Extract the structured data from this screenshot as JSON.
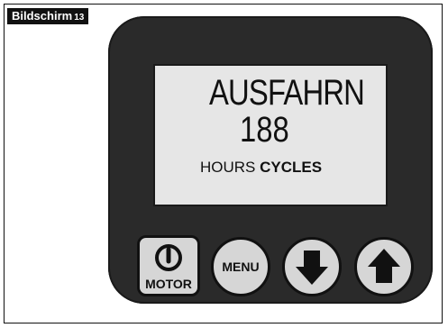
{
  "caption": {
    "label": "Bildschirm",
    "number": "13"
  },
  "display": {
    "line1": "AUSFAHRN",
    "line2": "188",
    "line3_normal": "HOURS",
    "line3_bold": "CYCLES"
  },
  "buttons": {
    "motor": {
      "label": "MOTOR",
      "icon": "power-icon"
    },
    "menu": {
      "label": "MENU"
    },
    "down": {
      "icon": "arrow-down-icon"
    },
    "up": {
      "icon": "arrow-up-icon"
    }
  },
  "colors": {
    "device_body": "#2a2a2a",
    "lcd_background": "#e6e6e6",
    "button_face": "#d6d6d6"
  }
}
